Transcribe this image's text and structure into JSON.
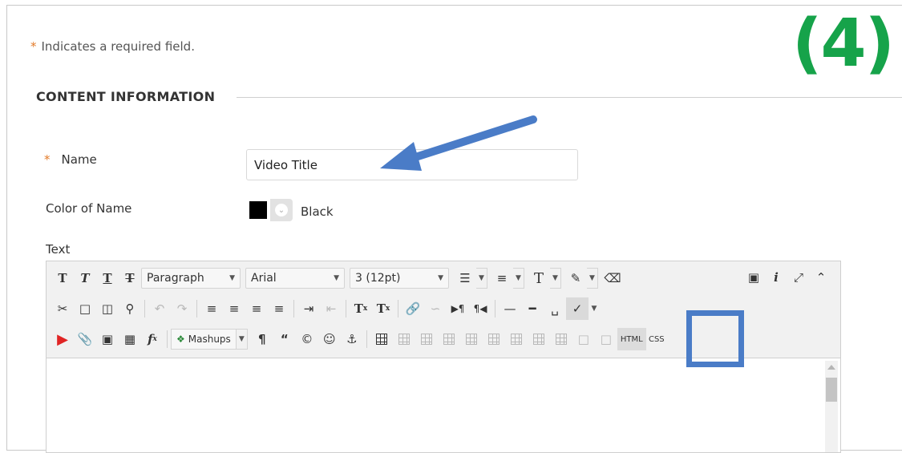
{
  "step_label": "(4)",
  "required_note": {
    "marker": "*",
    "text": "Indicates a required field."
  },
  "section_title": "CONTENT INFORMATION",
  "name_field": {
    "marker": "*",
    "label": "Name",
    "value": "Video Title"
  },
  "color_field": {
    "label": "Color of Name",
    "swatch_color": "#000000",
    "value": "Black"
  },
  "text_field": {
    "label": "Text"
  },
  "toolbar": {
    "format_select": "Paragraph",
    "font_select": "Arial",
    "size_select": "3 (12pt)",
    "mashups_label": "Mashups",
    "html_button": "HTML",
    "css_button": "CSS"
  },
  "annotations": {
    "arrow_color": "#4a7cc7",
    "highlight_color": "#4a7cc7",
    "step_color": "#16a34a"
  }
}
